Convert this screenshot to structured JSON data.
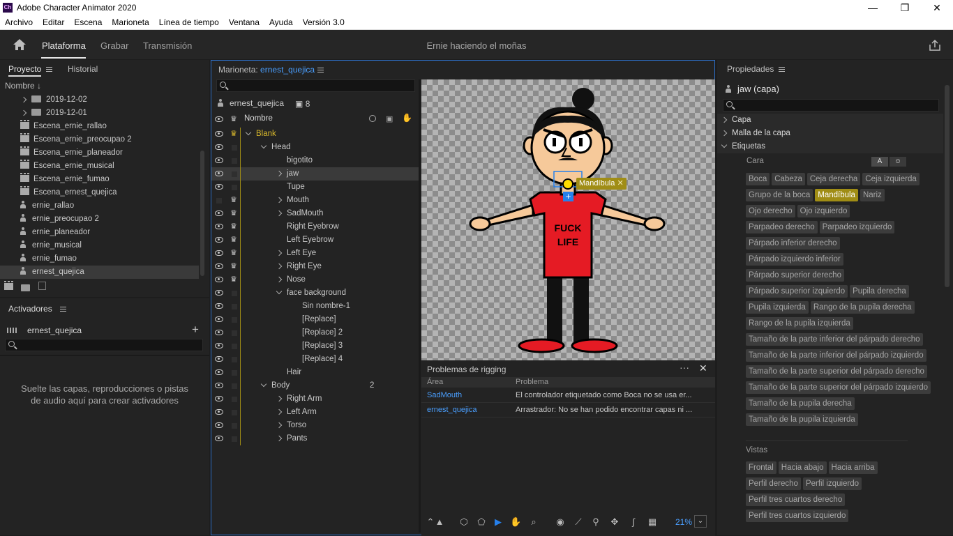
{
  "window": {
    "title": "Adobe Character Animator 2020",
    "logo": "Ch",
    "minimize": "—",
    "maximize": "❐",
    "close": "✕"
  },
  "menu": [
    "Archivo",
    "Editar",
    "Escena",
    "Marioneta",
    "Línea de tiempo",
    "Ventana",
    "Ayuda",
    "Versión 3.0"
  ],
  "appbar": {
    "tabs": [
      "Plataforma",
      "Grabar",
      "Transmisión"
    ],
    "active_tab": "Plataforma",
    "document_title": "Ernie haciendo el moñas",
    "icons": [
      "home-icon",
      "share-icon"
    ]
  },
  "project": {
    "tabs": [
      "Proyecto",
      "Historial"
    ],
    "sort_label": "Nombre",
    "items": [
      {
        "type": "folder",
        "label": "2019-12-02"
      },
      {
        "type": "folder",
        "label": "2019-12-01"
      },
      {
        "type": "scene",
        "label": "Escena_ernie_rallao"
      },
      {
        "type": "scene",
        "label": "Escena_ernie_preocupao 2"
      },
      {
        "type": "scene",
        "label": "Escena_ernie_planeador"
      },
      {
        "type": "scene",
        "label": "Escena_ernie_musical"
      },
      {
        "type": "scene",
        "label": "Escena_ernie_fumao"
      },
      {
        "type": "scene",
        "label": "Escena_ernest_quejica"
      },
      {
        "type": "puppet",
        "label": "ernie_rallao"
      },
      {
        "type": "puppet",
        "label": "ernie_preocupao 2"
      },
      {
        "type": "puppet",
        "label": "ernie_planeador"
      },
      {
        "type": "puppet",
        "label": "ernie_musical"
      },
      {
        "type": "puppet",
        "label": "ernie_fumao"
      },
      {
        "type": "puppet",
        "label": "ernest_quejica",
        "selected": true
      }
    ]
  },
  "triggers": {
    "title": "Activadores",
    "puppet": "ernest_quejica",
    "add": "+",
    "empty_text": "Suelte las capas, reproducciones o pistas de audio aquí para crear activadores"
  },
  "puppet_panel": {
    "title": "Marioneta:",
    "puppet_name": "ernest_quejica",
    "header_name": "ernest_quejica",
    "count": "8",
    "column_name": "Nombre",
    "layers": [
      {
        "label": "Blank",
        "indent": 0,
        "chev": "down",
        "crown": "gold",
        "eye": true
      },
      {
        "label": "Head",
        "indent": 1,
        "chev": "down",
        "crown": "",
        "eye": true
      },
      {
        "label": "bigotito",
        "indent": 2,
        "chev": "",
        "crown": "",
        "eye": true
      },
      {
        "label": "jaw",
        "indent": 2,
        "chev": "right",
        "crown": "",
        "eye": true,
        "selected": true
      },
      {
        "label": "Tupe",
        "indent": 2,
        "chev": "",
        "crown": "",
        "eye": true
      },
      {
        "label": "Mouth",
        "indent": 2,
        "chev": "right",
        "crown": "white",
        "eye": false
      },
      {
        "label": "SadMouth",
        "indent": 2,
        "chev": "right",
        "crown": "white",
        "eye": true
      },
      {
        "label": "Right Eyebrow",
        "indent": 2,
        "chev": "",
        "crown": "white",
        "eye": true
      },
      {
        "label": "Left Eyebrow",
        "indent": 2,
        "chev": "",
        "crown": "white",
        "eye": true
      },
      {
        "label": "Left Eye",
        "indent": 2,
        "chev": "right",
        "crown": "white",
        "eye": true
      },
      {
        "label": "Right Eye",
        "indent": 2,
        "chev": "right",
        "crown": "white",
        "eye": true
      },
      {
        "label": "Nose",
        "indent": 2,
        "chev": "right",
        "crown": "white",
        "eye": true
      },
      {
        "label": "face background",
        "indent": 2,
        "chev": "down",
        "crown": "",
        "eye": true
      },
      {
        "label": "Sin nombre-1",
        "indent": 3,
        "chev": "",
        "crown": "",
        "eye": true
      },
      {
        "label": "[Replace]",
        "indent": 3,
        "chev": "",
        "crown": "",
        "eye": true
      },
      {
        "label": "[Replace] 2",
        "indent": 3,
        "chev": "",
        "crown": "",
        "eye": true
      },
      {
        "label": "[Replace] 3",
        "indent": 3,
        "chev": "",
        "crown": "",
        "eye": true
      },
      {
        "label": "[Replace] 4",
        "indent": 3,
        "chev": "",
        "crown": "",
        "eye": true
      },
      {
        "label": "Hair",
        "indent": 2,
        "chev": "",
        "crown": "",
        "eye": true
      },
      {
        "label": "Body",
        "indent": 1,
        "chev": "down",
        "crown": "",
        "eye": true,
        "count": "2"
      },
      {
        "label": "Right Arm",
        "indent": 2,
        "chev": "right",
        "crown": "",
        "eye": true
      },
      {
        "label": "Left Arm",
        "indent": 2,
        "chev": "right",
        "crown": "",
        "eye": true
      },
      {
        "label": "Torso",
        "indent": 2,
        "chev": "right",
        "crown": "",
        "eye": true
      },
      {
        "label": "Pants",
        "indent": 2,
        "chev": "right",
        "crown": "",
        "eye": true
      }
    ]
  },
  "canvas": {
    "handle_label": "Mandíbula",
    "shirt_text_1": "FUCK",
    "shirt_text_2": "LIFE",
    "zoom": "21%"
  },
  "rigging": {
    "title": "Problemas de rigging",
    "col_area": "Área",
    "col_problem": "Problema",
    "rows": [
      {
        "area": "SadMouth",
        "problem": "El controlador etiquetado como Boca no se usa er..."
      },
      {
        "area": "ernest_quejica",
        "problem": "Arrastrador: No se han podido encontrar capas ni ..."
      }
    ]
  },
  "properties": {
    "title": "Propiedades",
    "layer_title": "jaw (capa)",
    "sections": [
      "Capa",
      "Malla de la capa",
      "Etiquetas"
    ],
    "face_label": "Cara",
    "face_tags": [
      [
        "Boca",
        "Cabeza",
        "Ceja derecha",
        "Ceja izquierda"
      ],
      [
        "Grupo de la boca",
        "Mandíbula",
        "Nariz"
      ],
      [
        "Ojo derecho",
        "Ojo izquierdo"
      ],
      [
        "Parpadeo derecho",
        "Parpadeo izquierdo"
      ],
      [
        "Párpado inferior derecho"
      ],
      [
        "Párpado izquierdo inferior"
      ],
      [
        "Párpado superior derecho"
      ],
      [
        "Párpado superior izquierdo",
        "Pupila derecha"
      ],
      [
        "Pupila izquierda",
        "Rango de la pupila derecha"
      ],
      [
        "Rango de la pupila izquierda"
      ],
      [
        "Tamaño de la parte inferior del párpado derecho"
      ],
      [
        "Tamaño de la parte inferior del párpado izquierdo"
      ],
      [
        "Tamaño de la parte superior del párpado derecho"
      ],
      [
        "Tamaño de la parte superior del párpado izquierdo"
      ],
      [
        "Tamaño de la pupila derecha"
      ],
      [
        "Tamaño de la pupila izquierda"
      ]
    ],
    "active_tag": "Mandíbula",
    "views_label": "Vistas",
    "view_tags": [
      [
        "Frontal",
        "Hacia abajo",
        "Hacia arriba"
      ],
      [
        "Perfil derecho",
        "Perfil izquierdo"
      ],
      [
        "Perfil tres cuartos derecho"
      ],
      [
        "Perfil tres cuartos izquierdo"
      ]
    ],
    "mode_a": "A"
  },
  "colors": {
    "accent_blue": "#2680eb",
    "tag_active": "#a08d15",
    "shirt": "#e51b24"
  }
}
